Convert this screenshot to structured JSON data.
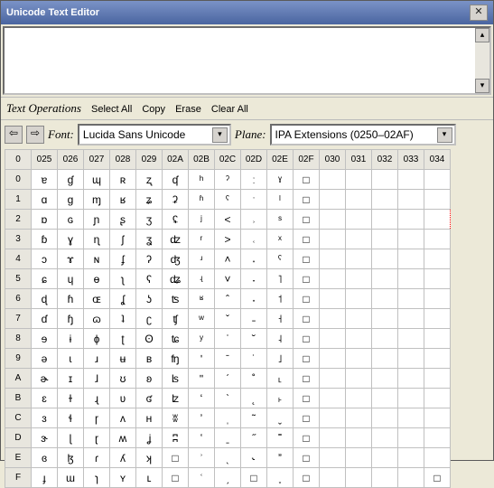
{
  "title": "Unicode Text Editor",
  "operations": {
    "header": "Text Operations",
    "items": [
      "Select All",
      "Copy",
      "Erase",
      "Clear All"
    ]
  },
  "toolbar": {
    "prev_arrow": "⇦",
    "next_arrow": "⇨",
    "font_label": "Font:",
    "font_value": "Lucida Sans Unicode",
    "plane_label": "Plane:",
    "plane_value": "IPA Extensions (0250–02AF)"
  },
  "grid": {
    "col_headers": [
      "0",
      "025",
      "026",
      "027",
      "028",
      "029",
      "02A",
      "02B",
      "02C",
      "02D",
      "02E",
      "02F",
      "030",
      "031",
      "032",
      "033",
      "034"
    ],
    "row_headers": [
      "0",
      "1",
      "2",
      "3",
      "4",
      "5",
      "6",
      "7",
      "8",
      "9",
      "A",
      "B",
      "C",
      "D",
      "E",
      "F"
    ],
    "highlight": {
      "row": 2,
      "col": 16
    },
    "cells": [
      [
        "ɐ",
        "ɠ",
        "ɰ",
        "ʀ",
        "ʐ",
        "ʠ",
        "ʰ",
        "ˀ",
        "ː",
        "ˠ",
        "□",
        "",
        "",
        "",
        "",
        ""
      ],
      [
        "ɑ",
        "ɡ",
        "ɱ",
        "ʁ",
        "ʑ",
        "ʡ",
        "ʱ",
        "ˁ",
        "ˑ",
        "ˡ",
        "□",
        "",
        "",
        "",
        "",
        ""
      ],
      [
        "ɒ",
        "ɢ",
        "ɲ",
        "ʂ",
        "ʒ",
        "ʢ",
        "ʲ",
        "˂",
        "˒",
        "ˢ",
        "□",
        "",
        "",
        "",
        "",
        ""
      ],
      [
        "ɓ",
        "ɣ",
        "ɳ",
        "ʃ",
        "ʓ",
        "ʣ",
        "ʳ",
        "˃",
        "˓",
        "ˣ",
        "□",
        "",
        "",
        "",
        "",
        ""
      ],
      [
        "ɔ",
        "ɤ",
        "ɴ",
        "ʄ",
        "ʔ",
        "ʤ",
        "ʴ",
        "˄",
        "˔",
        "ˤ",
        "□",
        "",
        "",
        "",
        "",
        ""
      ],
      [
        "ɕ",
        "ɥ",
        "ɵ",
        "ʅ",
        "ʕ",
        "ʥ",
        "ʵ",
        "˅",
        "˕",
        "˥",
        "□",
        "",
        "",
        "",
        "",
        ""
      ],
      [
        "ɖ",
        "ɦ",
        "ɶ",
        "ʆ",
        "ʖ",
        "ʦ",
        "ʶ",
        "ˆ",
        "˖",
        "˦",
        "□",
        "",
        "",
        "",
        "",
        ""
      ],
      [
        "ɗ",
        "ɧ",
        "ɷ",
        "ʇ",
        "ʗ",
        "ʧ",
        "ʷ",
        "ˇ",
        "˗",
        "˧",
        "□",
        "",
        "",
        "",
        "",
        ""
      ],
      [
        "ɘ",
        "ɨ",
        "ɸ",
        "ʈ",
        "ʘ",
        "ʨ",
        "ʸ",
        "ˈ",
        "˘",
        "˨",
        "□",
        "",
        "",
        "",
        "",
        ""
      ],
      [
        "ə",
        "ɩ",
        "ɹ",
        "ʉ",
        "ʙ",
        "ʩ",
        "ʹ",
        "ˉ",
        "˙",
        "˩",
        "□",
        "",
        "",
        "",
        "",
        ""
      ],
      [
        "ɚ",
        "ɪ",
        "ɺ",
        "ʊ",
        "ʚ",
        "ʪ",
        "ʺ",
        "ˊ",
        "˚",
        "˪",
        "□",
        "",
        "",
        "",
        "",
        ""
      ],
      [
        "ɛ",
        "ɫ",
        "ɻ",
        "ʋ",
        "ʛ",
        "ʫ",
        "ʻ",
        "ˋ",
        "˛",
        "˫",
        "□",
        "",
        "",
        "",
        "",
        ""
      ],
      [
        "ɜ",
        "ɬ",
        "ɼ",
        "ʌ",
        "ʜ",
        "ʬ",
        "ʼ",
        "ˌ",
        "˜",
        "ˬ",
        "□",
        "",
        "",
        "",
        "",
        ""
      ],
      [
        "ɝ",
        "ɭ",
        "ɽ",
        "ʍ",
        "ʝ",
        "ʭ",
        "ʽ",
        "ˍ",
        "˝",
        "˭",
        "□",
        "",
        "",
        "",
        "",
        ""
      ],
      [
        "ɞ",
        "ɮ",
        "ɾ",
        "ʎ",
        "ʞ",
        "□",
        "ʾ",
        "ˎ",
        "˞",
        "ˮ",
        "□",
        "",
        "",
        "",
        "",
        ""
      ],
      [
        "ɟ",
        "ɯ",
        "ɿ",
        "ʏ",
        "ʟ",
        "□",
        "ʿ",
        "ˏ",
        "□",
        "˯",
        "□",
        "",
        "",
        "",
        "",
        "□"
      ]
    ]
  }
}
